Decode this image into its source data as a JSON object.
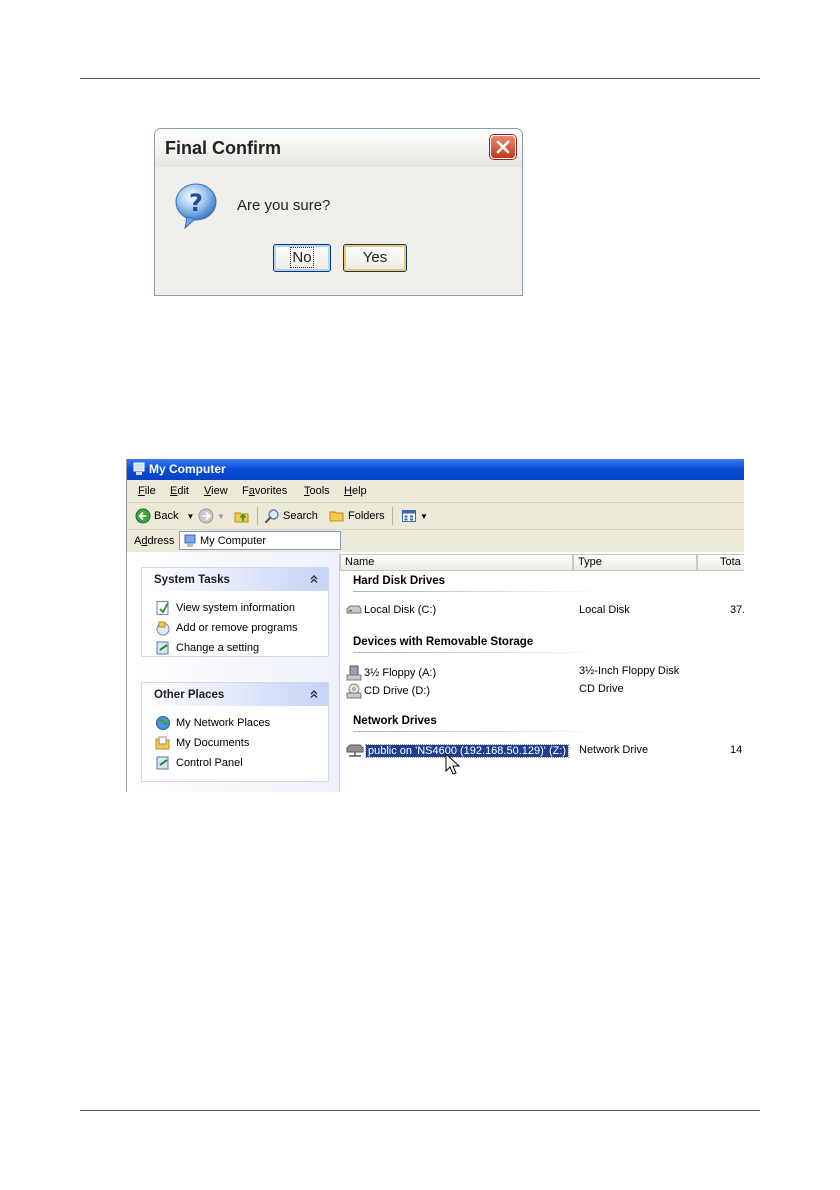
{
  "dialog": {
    "title": "Final Confirm",
    "message": "Are you sure?",
    "no_label": "No",
    "yes_label": "Yes",
    "icon": "question-icon"
  },
  "window": {
    "title": "My Computer",
    "menu": [
      {
        "key": "F",
        "rest": "ile"
      },
      {
        "key": "E",
        "rest": "dit"
      },
      {
        "key": "V",
        "rest": "iew"
      },
      {
        "key": "F",
        "rest": "avorites",
        "pre": ""
      },
      {
        "key": "T",
        "rest": "ools"
      },
      {
        "key": "H",
        "rest": "elp"
      }
    ],
    "toolbar": {
      "back": "Back",
      "search": "Search",
      "folders": "Folders"
    },
    "address": {
      "label_key": "d",
      "label_pre": "A",
      "label_rest": "dress",
      "value": "My Computer"
    },
    "system_tasks": {
      "title": "System Tasks",
      "items": [
        "View system information",
        "Add or remove programs",
        "Change a setting"
      ]
    },
    "other_places": {
      "title": "Other Places",
      "items": [
        "My Network Places",
        "My Documents",
        "Control Panel"
      ]
    },
    "columns": [
      "Name",
      "Type",
      "Tota"
    ],
    "groups": {
      "hard_disk": "Hard Disk Drives",
      "removable": "Devices with Removable Storage",
      "network": "Network Drives"
    },
    "rows": {
      "local_disk": {
        "name": "Local Disk (C:)",
        "type": "Local Disk",
        "total": "37."
      },
      "floppy": {
        "name": "3½ Floppy (A:)",
        "type": "3½-Inch Floppy Disk"
      },
      "cd": {
        "name": "CD Drive (D:)",
        "type": "CD Drive"
      },
      "network": {
        "name": "public on 'NS4600 (192.168.50.129)' (Z:)",
        "type": "Network Drive",
        "total": "14"
      }
    }
  }
}
